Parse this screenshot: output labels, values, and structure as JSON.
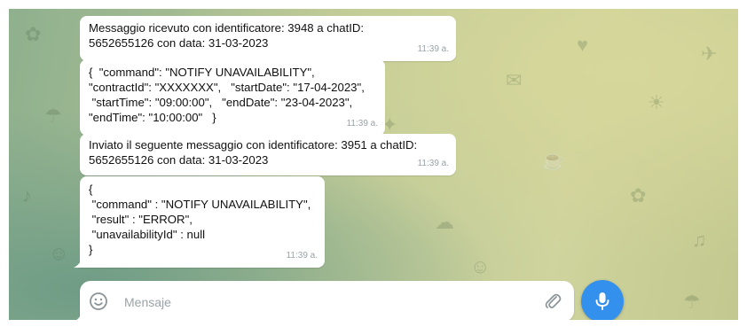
{
  "messages": [
    {
      "text": "Messaggio ricevuto con identificatore: 3948 a chatID:\n5652655126 con data: 31-03-2023",
      "time": "11:39 a."
    },
    {
      "text": "{  \"command\": \"NOTIFY UNAVAILABILITY\",\n\"contractId\": \"XXXXXXX\",   \"startDate\": \"17-04-2023\",\n \"startTime\": \"09:00:00\",   \"endDate\": \"23-04-2023\",\n\"endTime\": \"10:00:00\"   }",
      "time": "11:39 a."
    },
    {
      "text": "Inviato il seguente messaggio con identificatore: 3951 a chatID:\n5652655126 con data: 31-03-2023",
      "time": "11:39 a."
    },
    {
      "text": "{\n \"command\" : \"NOTIFY UNAVAILABILITY\",\n \"result\" : \"ERROR\",\n \"unavailabilityId\" : null\n}",
      "time": "11:39 a."
    }
  ],
  "composer": {
    "placeholder": "Mensaje",
    "value": ""
  },
  "icons": {
    "emoji": "smiley-icon",
    "attach": "paperclip-icon",
    "send": "microphone-icon"
  },
  "colors": {
    "accent": "#3390ec",
    "bubble": "#ffffff",
    "timestamp": "#9aa3a8"
  }
}
